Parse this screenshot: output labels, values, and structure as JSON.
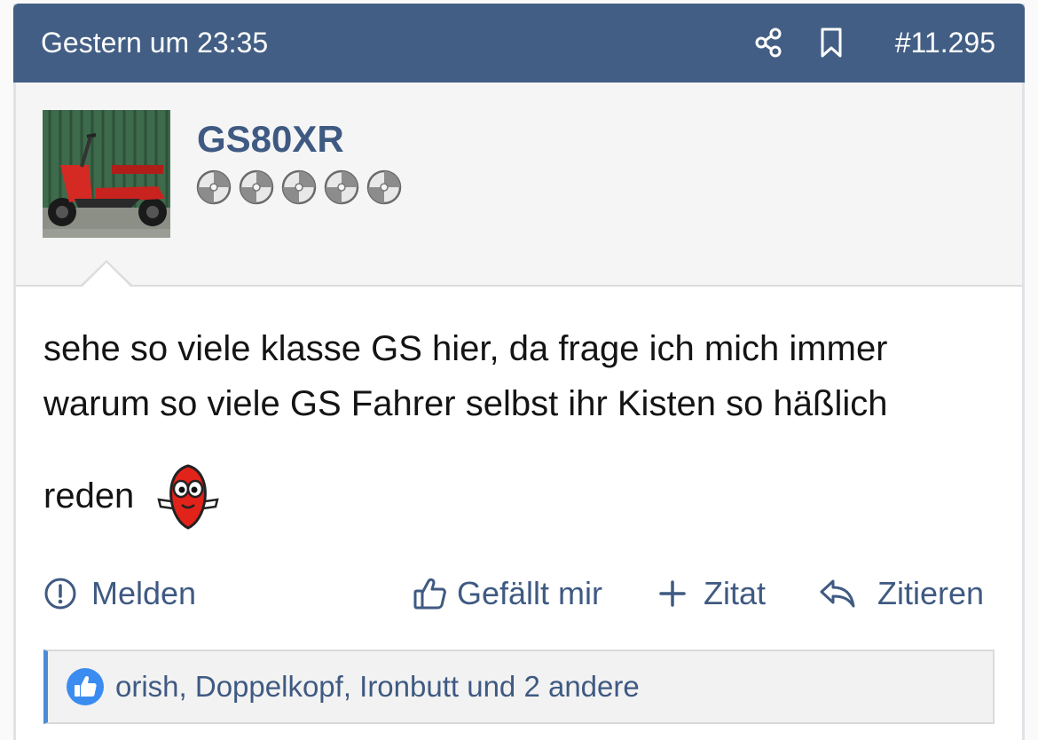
{
  "post": {
    "date": "Gestern um 23:35",
    "number": "#11.295",
    "icons": {
      "share": "share-icon",
      "bookmark": "bookmark-icon"
    }
  },
  "author": {
    "username": "GS80XR",
    "avatar": "avatar-red-scooter",
    "rank_icon": "rank-wheels-icon"
  },
  "message": {
    "lines": [
      "sehe so viele klasse GS hier, da frage ich mich immer",
      "warum so viele GS Fahrer selbst ihr Kisten so häßlich",
      "reden"
    ],
    "smiley": "red-shy-smiley"
  },
  "actions": {
    "report": "Melden",
    "like": "Gefällt mir",
    "quote": "Zitat",
    "reply": "Zitieren"
  },
  "likes": {
    "text": "orish, Doppelkopf, Ironbutt und 2 andere"
  },
  "colors": {
    "header_bg": "#425e84",
    "link": "#3f5a82",
    "likes_accent": "#4b8bd8"
  }
}
